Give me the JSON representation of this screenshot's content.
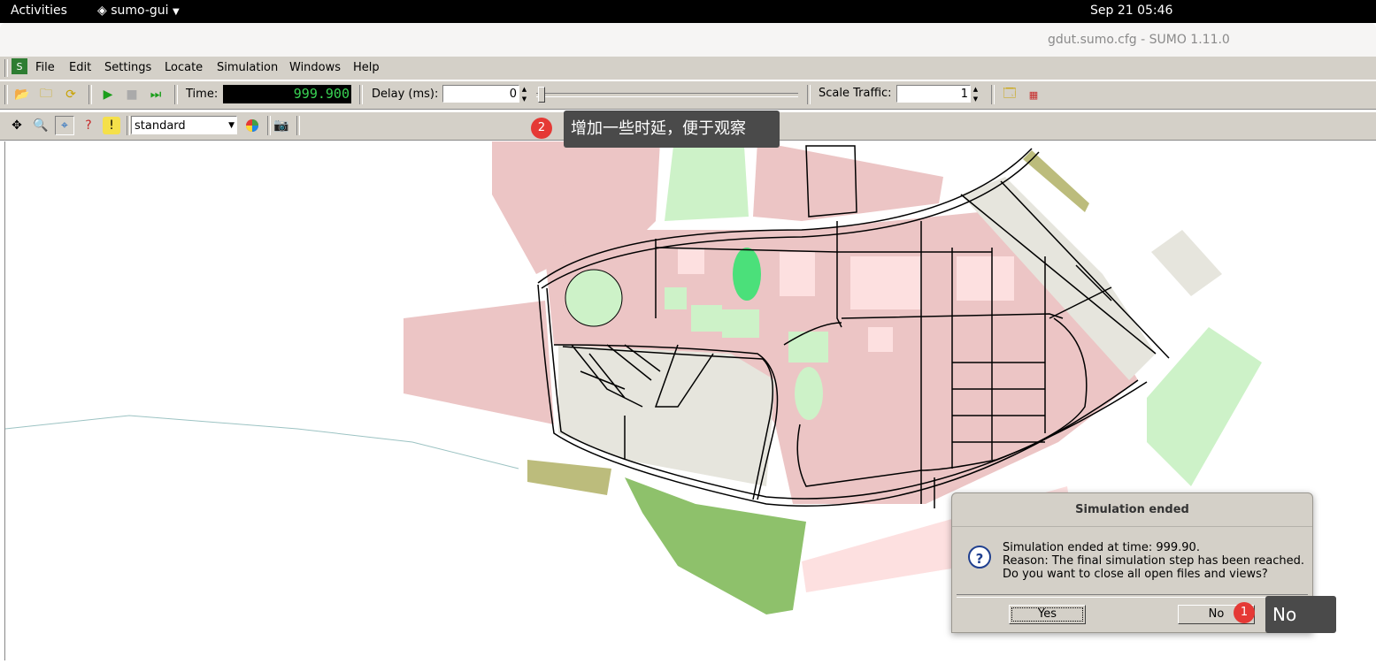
{
  "topbar": {
    "activities": "Activities",
    "app_menu": "sumo-gui",
    "clock": "Sep 21  05:46"
  },
  "window": {
    "title": "gdut.sumo.cfg - SUMO 1.11.0"
  },
  "menu": {
    "file": "File",
    "edit": "Edit",
    "settings": "Settings",
    "locate": "Locate",
    "simulation": "Simulation",
    "windows": "Windows",
    "help": "Help"
  },
  "toolbar": {
    "time_label": "Time:",
    "time_value": "999.900",
    "delay_label": "Delay (ms):",
    "delay_value": "0",
    "scale_label": "Scale Traffic:",
    "scale_value": "1"
  },
  "view_toolbar": {
    "scheme": "standard"
  },
  "annotations": {
    "step1_number": "1",
    "step1_text": "No",
    "step2_number": "2",
    "step2_text": "增加一些时延，便于观察"
  },
  "dialog": {
    "title": "Simulation ended",
    "line1": "Simulation ended at time: 999.90.",
    "line2": "Reason: The final simulation step has been reached.",
    "line3": "Do you want to close all open files and views?",
    "yes": "Yes",
    "no": "No"
  },
  "colors": {
    "accent_badge": "#e53935",
    "building": "#ecc5c5",
    "park": "#cdf2c8",
    "grass": "#8ec16b",
    "tooltip": "#4a4a4a"
  }
}
